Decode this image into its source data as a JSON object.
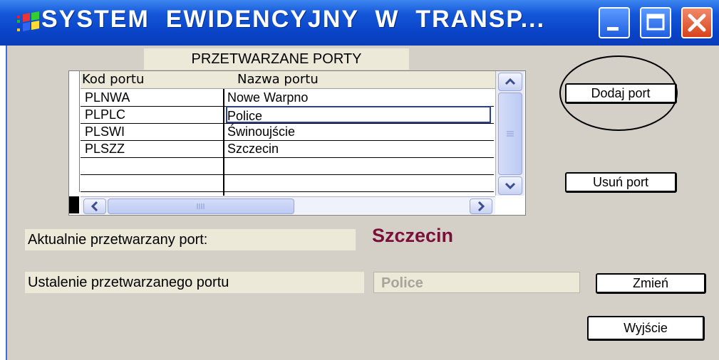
{
  "window": {
    "title": "SYSTEM  EWIDENCYJNY  W  TRANSP...",
    "colors": {
      "titlebar": "#0a44c8",
      "client": "#d4d0c8",
      "accent_text": "#7a0f3a"
    }
  },
  "header_label": "PRZETWARZANE  PORTY",
  "grid": {
    "columns": [
      "Kod portu",
      "Nazwa portu"
    ],
    "rows": [
      {
        "code": "PLNWA",
        "name": "Nowe Warpno"
      },
      {
        "code": "PLPLC",
        "name": "Police"
      },
      {
        "code": "PLSWI",
        "name": "Świnoujście"
      },
      {
        "code": "PLSZZ",
        "name": "Szczecin"
      },
      {
        "code": "",
        "name": ""
      },
      {
        "code": "",
        "name": ""
      }
    ]
  },
  "buttons": {
    "add_port": "Dodaj port",
    "remove_port": "Usuń port",
    "change": "Zmień",
    "exit": "Wyjście"
  },
  "current_port": {
    "label": "Aktualnie przetwarzany port:",
    "value": "Szczecin"
  },
  "set_port": {
    "label": "Ustalenie przetwarzanego portu",
    "value": "Police"
  },
  "icons": {
    "window_icon": "app-flag-icon",
    "minimize": "minimize-icon",
    "maximize": "maximize-icon",
    "close": "close-icon"
  }
}
